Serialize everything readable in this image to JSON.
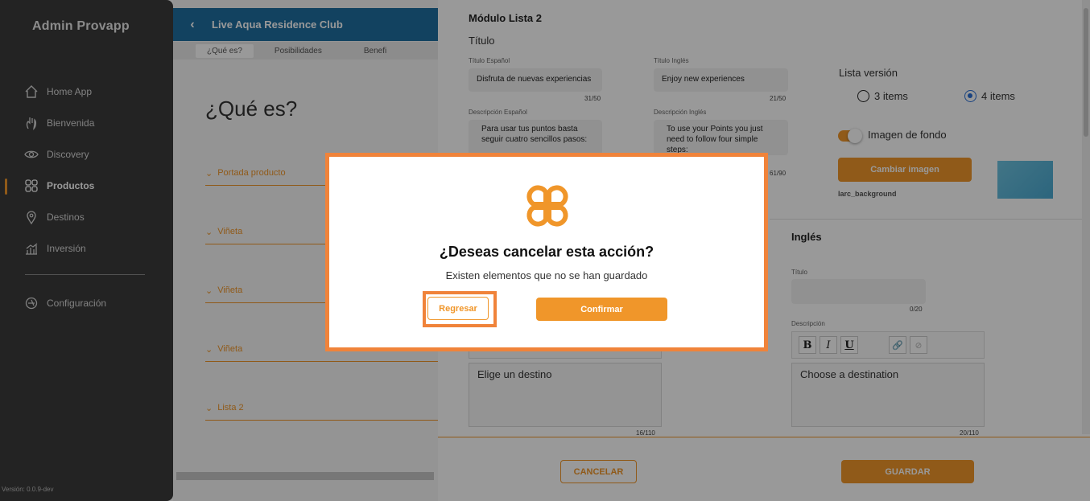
{
  "app": {
    "brand": "Admin Provapp",
    "version": "Versión: 0.0.9-dev"
  },
  "sidebar": {
    "items": [
      {
        "label": "Home App",
        "icon": "home-icon"
      },
      {
        "label": "Bienvenida",
        "icon": "hand-icon"
      },
      {
        "label": "Discovery",
        "icon": "eye-icon"
      },
      {
        "label": "Productos",
        "icon": "grid-icon",
        "active": true
      },
      {
        "label": "Destinos",
        "icon": "location-pin-icon"
      },
      {
        "label": "Inversión",
        "icon": "chart-icon"
      }
    ],
    "config_label": "Configuración"
  },
  "main": {
    "header_title": "Live Aqua Residence Club",
    "tabs": [
      "¿Qué es?",
      "Posibilidades",
      "Benefi"
    ],
    "page_title": "¿Qué es?",
    "sections": [
      "Portada producto",
      "Viñeta",
      "Viñeta",
      "Viñeta",
      "Lista 2"
    ]
  },
  "drawer": {
    "module_title": "Módulo Lista 2",
    "titulo_heading": "Título",
    "titulo_es_label": "Título Español",
    "titulo_es_value": "Disfruta de nuevas experiencias",
    "titulo_es_counter": "31/50",
    "titulo_en_label": "Título Inglés",
    "titulo_en_value": "Enjoy new experiences",
    "titulo_en_counter": "21/50",
    "desc_es_label": "Descripción Español",
    "desc_es_value": "Para usar tus puntos basta seguir cuatro sencillos pasos:",
    "desc_en_label": "Descripción Inglés",
    "desc_en_value": "To use your Points you just need to follow four simple steps:",
    "desc_en_counter": "61/90",
    "lista_version_label": "Lista versión",
    "option_3": "3 items",
    "option_4": "4 items",
    "option_selected": "4 items",
    "bg_toggle_label": "Imagen de fondo",
    "bg_toggle_on": true,
    "change_image_label": "Cambiar imagen",
    "image_name": "larc_background",
    "ingles_heading": "Inglés",
    "en_titulo_label": "Título",
    "en_titulo_counter": "0/20",
    "en_desc_label": "Descripción",
    "es_rte_value": "Elige un destino",
    "es_rte_counter": "16/110",
    "en_rte_value": "Choose a destination",
    "en_rte_counter": "20/110",
    "cancel_label": "CANCELAR",
    "save_label": "GUARDAR"
  },
  "modal": {
    "title": "¿Deseas cancelar esta acción?",
    "subtitle": "Existen elementos que no se han guardado",
    "back_label": "Regresar",
    "confirm_label": "Confirmar"
  },
  "colors": {
    "accent": "#f0962a",
    "highlight": "#f0833a",
    "sidebar_bg": "#3b3b3b",
    "header_bg": "#1f6ea0",
    "radio_selected": "#2b6fd6"
  }
}
